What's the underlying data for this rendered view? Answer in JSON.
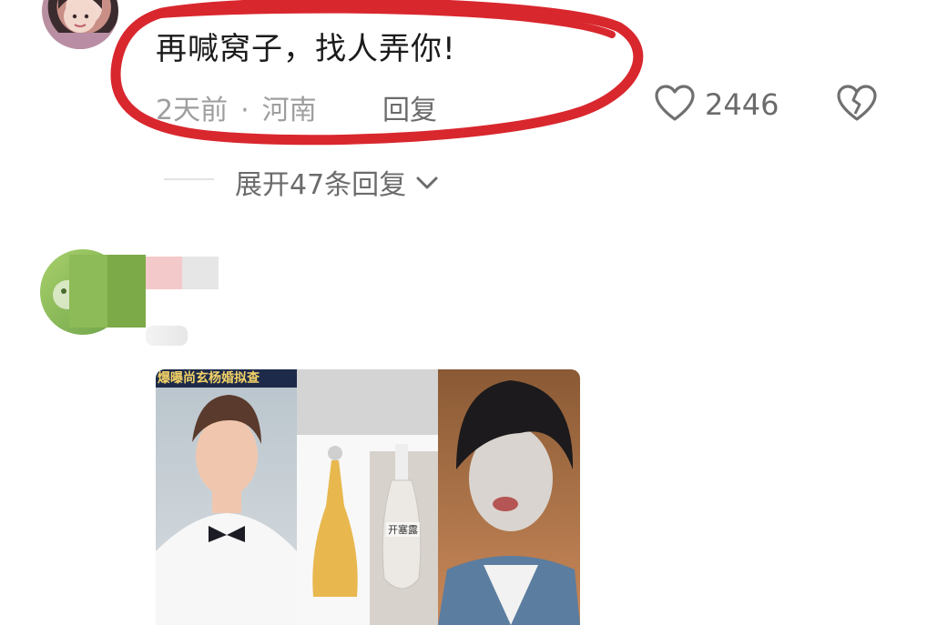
{
  "comment": {
    "text": "再喊窝子，找人弄你!",
    "time": "2天前",
    "separator": "·",
    "location": "河南",
    "reply_label": "回复",
    "like_count": "2446"
  },
  "expand": {
    "label": "展开47条回复"
  },
  "collage": {
    "banner_text": "爆曝尚玄杨婚拟查",
    "bottle_label": "开塞露"
  },
  "colors": {
    "annotation_red": "#d9272e",
    "meta_gray": "#9e9e9e",
    "text_dark": "#1b1b1b"
  },
  "icons": {
    "like": "heart-outline-icon",
    "dislike": "broken-heart-icon",
    "expand": "chevron-down-icon"
  }
}
